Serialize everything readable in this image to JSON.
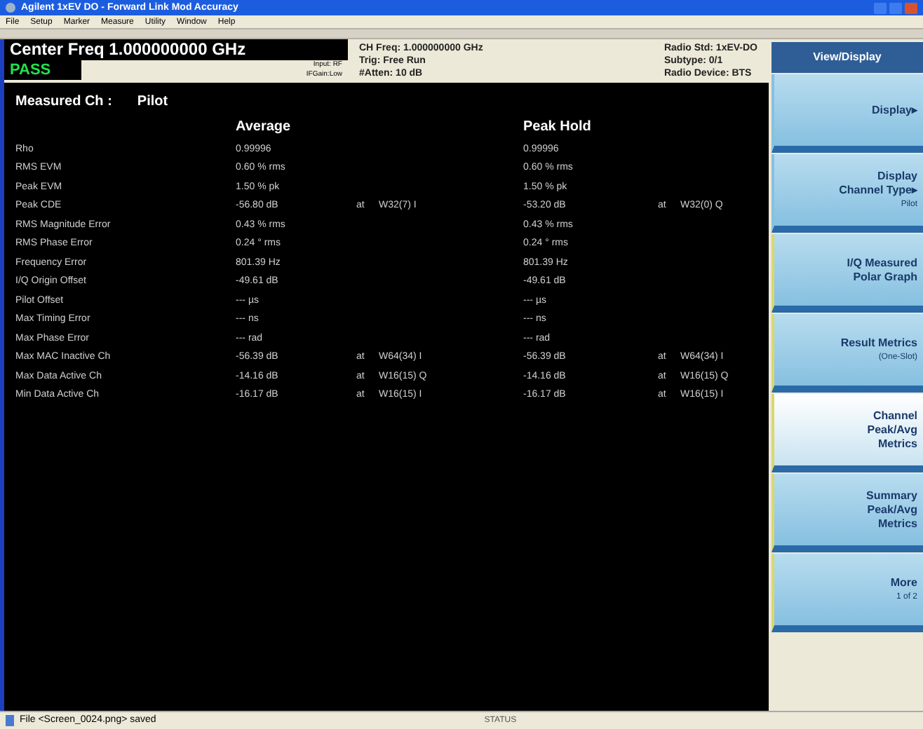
{
  "window": {
    "title": "Agilent 1xEV DO - Forward Link Mod Accuracy"
  },
  "menu": [
    "File",
    "Setup",
    "Marker",
    "Measure",
    "Utility",
    "Window",
    "Help"
  ],
  "header": {
    "center_freq": "Center Freq  1.000000000 GHz",
    "verdict": "PASS",
    "input": "Input: RF",
    "if_gain": "IFGain:Low",
    "settings": [
      "CH Freq: 1.000000000 GHz",
      "Trig: Free Run",
      "#Atten: 10 dB"
    ],
    "radio": [
      "Radio Std: 1xEV-DO",
      "Subtype: 0/1",
      "Radio Device: BTS"
    ]
  },
  "measured_label": "Measured Ch :",
  "measured_value": "Pilot",
  "columns": [
    "Average",
    "Peak Hold"
  ],
  "rows": [
    {
      "name": "Rho",
      "avg": "0.99996",
      "peak": "0.99996"
    },
    {
      "name": "RMS EVM",
      "avg": "0.60 % rms",
      "peak": "0.60 % rms"
    },
    {
      "name": "Peak EVM",
      "avg": "1.50 % pk",
      "peak": "1.50 % pk"
    },
    {
      "name": "Peak CDE",
      "avg": "-56.80 dB",
      "avg_at": "at",
      "avg_code": "W32(7) I",
      "peak": "-53.20 dB",
      "peak_at": "at",
      "peak_code": "W32(0) Q"
    },
    {
      "name": "RMS Magnitude Error",
      "avg": "0.43 % rms",
      "peak": "0.43 % rms"
    },
    {
      "name": "RMS Phase Error",
      "avg": "0.24 ° rms",
      "peak": "0.24 ° rms"
    },
    {
      "name": "Frequency Error",
      "avg": "801.39 Hz",
      "peak": "801.39 Hz"
    },
    {
      "name": "I/Q Origin Offset",
      "avg": "-49.61 dB",
      "peak": "-49.61 dB"
    },
    {
      "name": "Pilot Offset",
      "avg": "--- µs",
      "peak": "--- µs"
    },
    {
      "name": "Max Timing Error",
      "avg": "--- ns",
      "peak": "--- ns"
    },
    {
      "name": "Max Phase Error",
      "avg": "--- rad",
      "peak": "--- rad"
    },
    {
      "name": "Max MAC Inactive Ch",
      "avg": "-56.39 dB",
      "avg_at": "at",
      "avg_code": "W64(34) I",
      "peak": "-56.39 dB",
      "peak_at": "at",
      "peak_code": "W64(34) I"
    },
    {
      "name": "Max Data Active Ch",
      "avg": "-14.16 dB",
      "avg_at": "at",
      "avg_code": "W16(15) Q",
      "peak": "-14.16 dB",
      "peak_at": "at",
      "peak_code": "W16(15) Q"
    },
    {
      "name": "Min Data Active Ch",
      "avg": "-16.17 dB",
      "avg_at": "at",
      "avg_code": "W16(15) I",
      "peak": "-16.17 dB",
      "peak_at": "at",
      "peak_code": "W16(15) I"
    }
  ],
  "softkey_title": "View/Display",
  "softkeys": [
    {
      "lines": [
        "Display▸"
      ],
      "selected": false
    },
    {
      "lines": [
        "Display",
        "Channel Type▸"
      ],
      "sub": "Pilot",
      "selected": false
    },
    {
      "lines": [
        "I/Q Measured",
        "Polar Graph"
      ],
      "selected": false
    },
    {
      "lines": [
        "Result Metrics"
      ],
      "sub": "(One-Slot)",
      "selected": false
    },
    {
      "lines": [
        "Channel",
        "Peak/Avg",
        "Metrics"
      ],
      "selected": true
    },
    {
      "lines": [
        "Summary",
        "Peak/Avg",
        "Metrics"
      ],
      "selected": false
    },
    {
      "lines": [
        "More"
      ],
      "sub": "1 of 2",
      "selected": false
    }
  ],
  "status_bar": {
    "message": "File <Screen_0024.png> saved",
    "status": "STATUS"
  }
}
